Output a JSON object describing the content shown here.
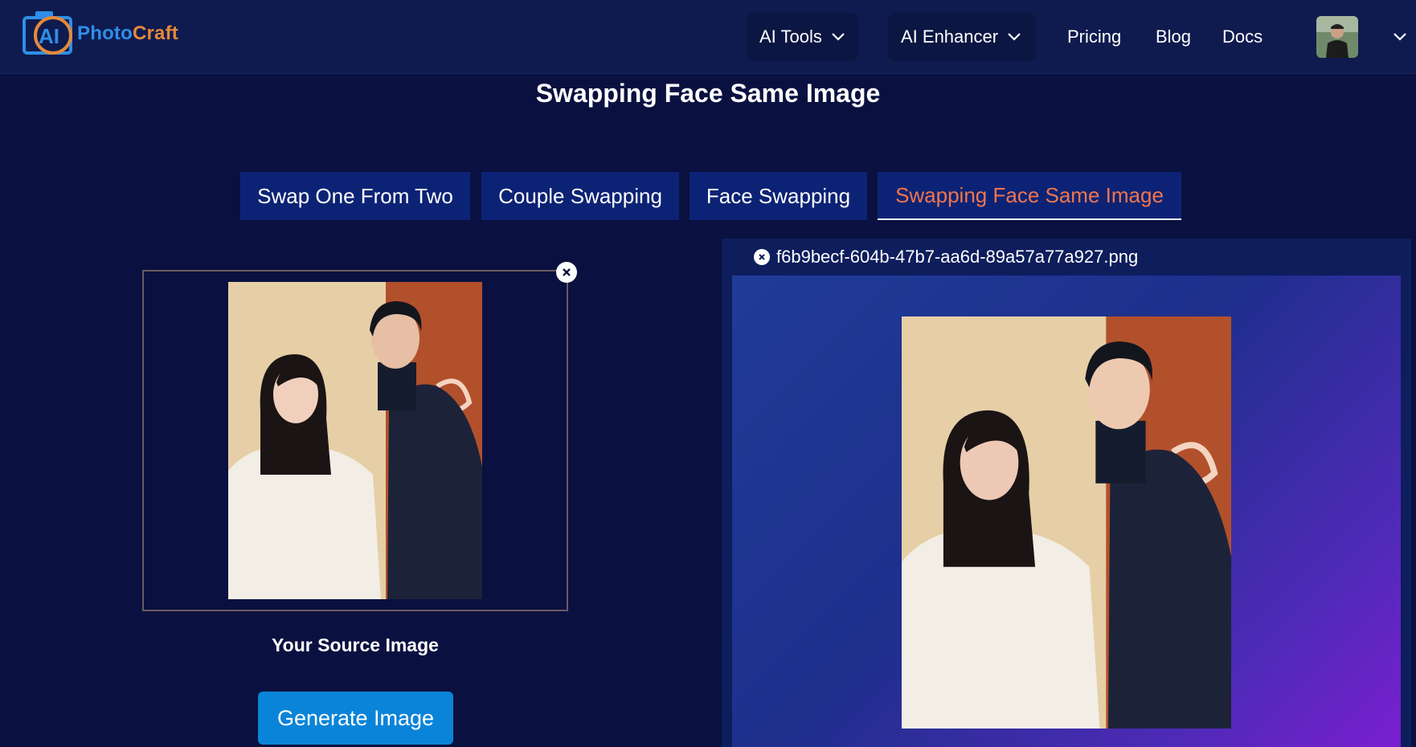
{
  "brand": {
    "logo_badge": "AI",
    "logo_word_1": "Photo",
    "logo_word_2": "Craft"
  },
  "nav": {
    "ai_tools": "AI Tools",
    "ai_enhancer": "AI Enhancer",
    "pricing": "Pricing",
    "blog": "Blog",
    "docs": "Docs"
  },
  "page": {
    "title": "Swapping Face Same Image"
  },
  "tabs": [
    {
      "label": "Swap One From Two",
      "active": false
    },
    {
      "label": "Couple Swapping",
      "active": false
    },
    {
      "label": "Face Swapping",
      "active": false
    },
    {
      "label": "Swapping Face Same Image",
      "active": true
    }
  ],
  "source": {
    "caption": "Your Source Image",
    "generate_label": "Generate Image"
  },
  "result": {
    "file_name": "f6b9becf-604b-47b7-aa6d-89a57a77a927.png"
  },
  "colors": {
    "page_bg": "#0a1140",
    "navbar_bg": "#0f1b4e",
    "tab_bg": "#0c2375",
    "active_tab_text": "#f2754c",
    "button_bg": "#0a84d8",
    "brand_blue": "#2f8ee8",
    "brand_orange": "#e58a3a"
  }
}
